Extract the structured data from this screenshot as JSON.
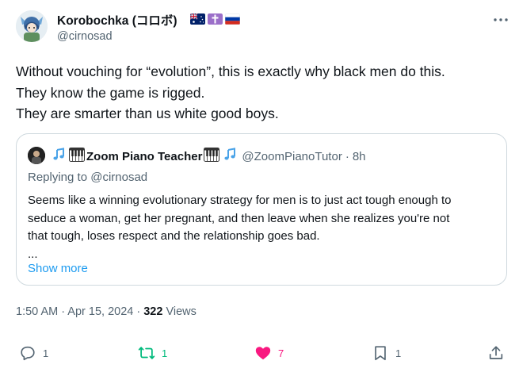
{
  "author": {
    "name": "Korobochka (コロボ)",
    "handle": "@cirnosad",
    "flags": [
      "australia-flag",
      "orthodox-cross-icon",
      "russia-flag"
    ]
  },
  "tweet": {
    "lines": [
      "Without vouching for “evolution”, this is exactly why black men do this.",
      "They know the game is rigged.",
      "They are smarter than us white good boys."
    ]
  },
  "quote": {
    "name": "Zoom Piano Teacher",
    "handle": "@ZoomPianoTutor",
    "time": "8h",
    "replying_to": "Replying to @cirnosad",
    "body_lines": [
      "Seems like a winning evolutionary strategy for men is to just act tough enough to",
      "seduce a woman, get her pregnant, and then leave when she realizes you're not",
      "that tough, loses respect and the relationship goes bad.",
      "..."
    ],
    "show_more": "Show more"
  },
  "meta": {
    "time": "1:50 AM",
    "date": "Apr 15, 2024",
    "views_count": "322",
    "views_label": "Views"
  },
  "actions": {
    "reply_count": "1",
    "retweet_count": "1",
    "like_count": "7",
    "bookmark_count": "1"
  },
  "colors": {
    "retweet": "#00ba7c",
    "like": "#f91880",
    "link": "#1d9bf0",
    "muted": "#536471"
  }
}
